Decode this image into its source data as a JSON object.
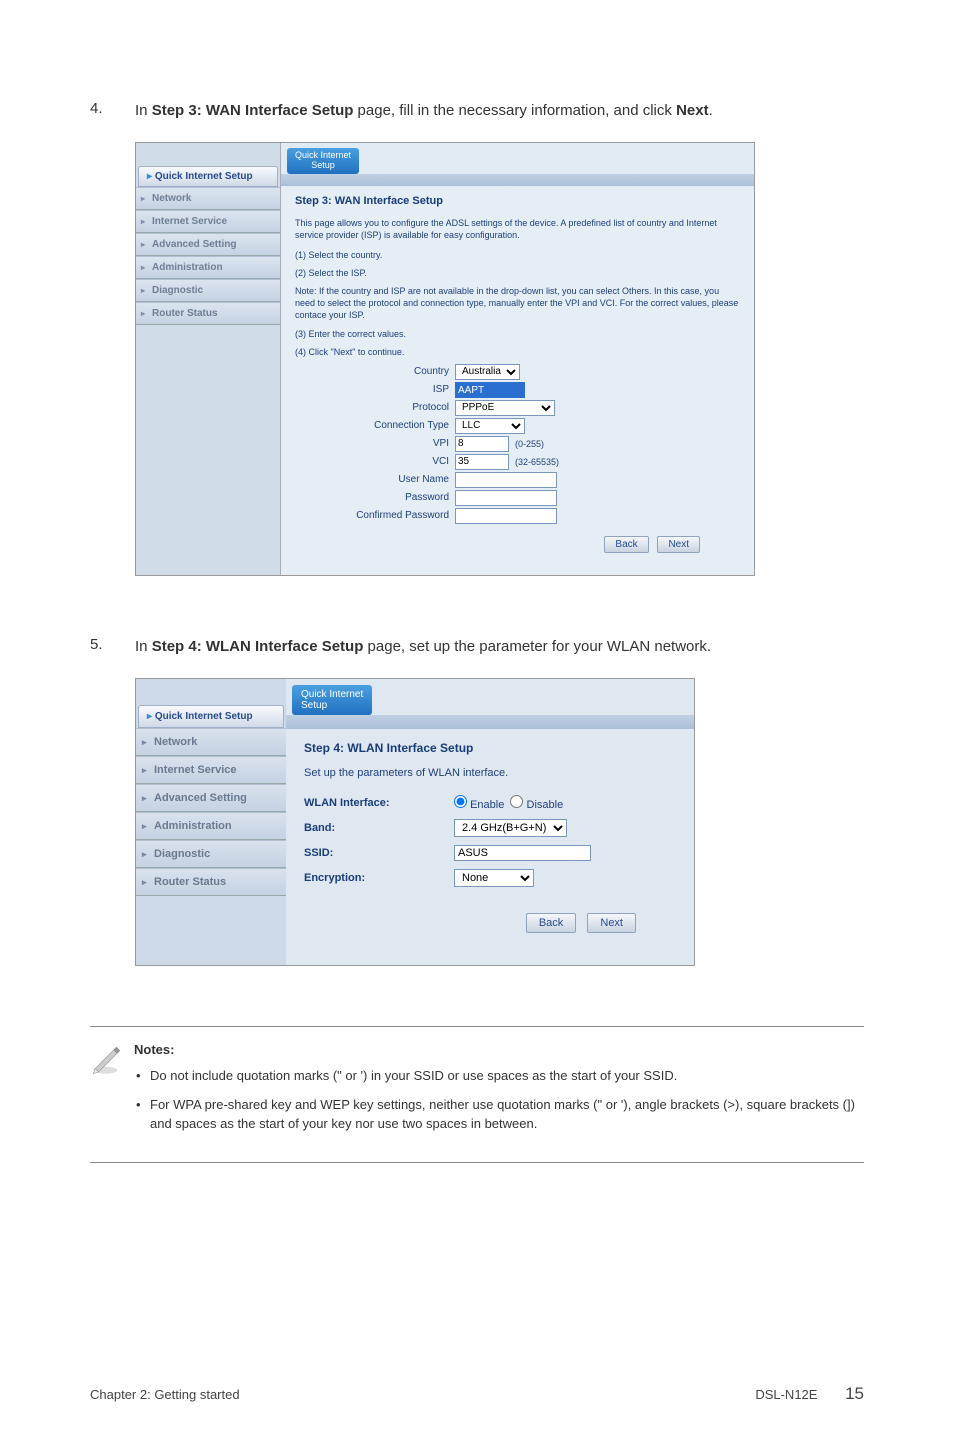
{
  "step4": {
    "num": "4.",
    "text_prefix": "In ",
    "text_bold": "Step 3: WAN Interface Setup",
    "text_mid": " page, fill in the necessary information, and click ",
    "text_bold2": "Next",
    "text_end": "."
  },
  "step5": {
    "num": "5.",
    "text_prefix": "In ",
    "text_bold": "Step 4: WLAN Interface Setup",
    "text_mid": " page, set up the parameter for your WLAN network.",
    "text_bold2": "",
    "text_end": ""
  },
  "ss1": {
    "pill": "Quick Internet\nSetup",
    "sidebar_title": "Quick Internet Setup",
    "sidebar": [
      "Network",
      "Internet Service",
      "Advanced Setting",
      "Administration",
      "Diagnostic",
      "Router Status"
    ],
    "title": "Step 3: WAN Interface Setup",
    "desc": "This page allows you to configure the ADSL settings of the device. A predefined list of country and Internet service provider (ISP) is available for easy configuration.",
    "l1": "(1) Select the country.",
    "l2": "(2) Select the ISP.",
    "note": "Note: If the country and ISP are not available in the drop-down list, you can select Others. In this case, you need to select the protocol and connection type, manually enter the VPI and VCI. For the correct values, please contace your ISP.",
    "l3": "(3) Enter the correct values.",
    "l4": "(4) Click \"Next\" to continue.",
    "fields": {
      "country_lbl": "Country",
      "country_val": "Australia",
      "isp_lbl": "ISP",
      "isp_val": "AAPT",
      "protocol_lbl": "Protocol",
      "protocol_val": "PPPoE",
      "conn_lbl": "Connection Type",
      "conn_val": "LLC",
      "vpi_lbl": "VPI",
      "vpi_val": "8",
      "vpi_hint": "(0-255)",
      "vci_lbl": "VCI",
      "vci_val": "35",
      "vci_hint": "(32-65535)",
      "user_lbl": "User Name",
      "pwd_lbl": "Password",
      "cpwd_lbl": "Confirmed Password"
    },
    "back": "Back",
    "next": "Next"
  },
  "ss2": {
    "pill": "Quick Internet\nSetup",
    "sidebar_title": "Quick Internet Setup",
    "sidebar": [
      "Network",
      "Internet Service",
      "Advanced Setting",
      "Administration",
      "Diagnostic",
      "Router Status"
    ],
    "title": "Step 4: WLAN Interface Setup",
    "desc": "Set up the parameters of WLAN interface.",
    "fields": {
      "wlan_lbl": "WLAN Interface:",
      "wlan_enable": "Enable",
      "wlan_disable": "Disable",
      "band_lbl": "Band:",
      "band_val": "2.4 GHz(B+G+N)",
      "ssid_lbl": "SSID:",
      "ssid_val": "ASUS",
      "enc_lbl": "Encryption:",
      "enc_val": "None"
    },
    "back": "Back",
    "next": "Next"
  },
  "notes": {
    "title": "Notes:",
    "n1": "Do not include quotation marks (\" or ') in your SSID or use spaces as the start of your SSID.",
    "n2": "For WPA pre-shared key and WEP key settings, neither use quotation marks (\" or '), angle brackets (>), square brackets (]) and spaces as the start of your key nor use two spaces in between."
  },
  "footer": {
    "left": "Chapter 2: Getting started",
    "right_label": "DSL-N12E",
    "page": "15"
  }
}
